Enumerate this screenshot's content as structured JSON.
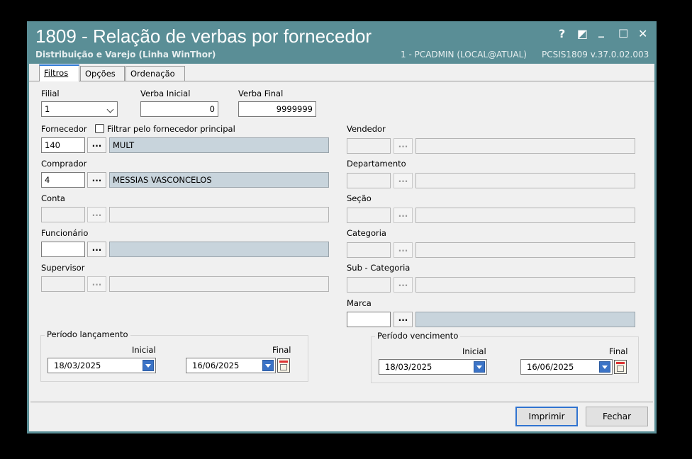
{
  "window": {
    "title": "1809 - Relação de verbas por fornecedor",
    "subtitle": "Distribuição e Varejo (Linha WinThor)",
    "user_info": "1 - PCADMIN (LOCAL@ATUAL)",
    "version": "PCSIS1809  v.37.0.02.003",
    "controls": {
      "help": "?",
      "restore": "◩",
      "minimize": "_",
      "maximize": "☐",
      "close": "✕"
    }
  },
  "tabs": [
    {
      "label": "Filtros",
      "active": true
    },
    {
      "label": "Opções",
      "active": false
    },
    {
      "label": "Ordenação",
      "active": false
    }
  ],
  "filters": {
    "filial": {
      "label": "Filial",
      "value": "1"
    },
    "verba_inicial": {
      "label": "Verba Inicial",
      "value": "0"
    },
    "verba_final": {
      "label": "Verba Final",
      "value": "9999999"
    },
    "fornecedor": {
      "label": "Fornecedor",
      "code": "140",
      "name": "MULT",
      "checkbox_label": "Filtrar pelo fornecedor principal",
      "checked": false
    },
    "comprador": {
      "label": "Comprador",
      "code": "4",
      "name": "MESSIAS VASCONCELOS"
    },
    "conta": {
      "label": "Conta",
      "code": "",
      "name": ""
    },
    "funcionario": {
      "label": "Funcionário",
      "code": "",
      "name": ""
    },
    "supervisor": {
      "label": "Supervisor",
      "code": "",
      "name": ""
    },
    "vendedor": {
      "label": "Vendedor",
      "code": "",
      "name": ""
    },
    "departamento": {
      "label": "Departamento",
      "code": "",
      "name": ""
    },
    "secao": {
      "label": "Seção",
      "code": "",
      "name": ""
    },
    "categoria": {
      "label": "Categoria",
      "code": "",
      "name": ""
    },
    "subcategoria": {
      "label": "Sub - Categoria",
      "code": "",
      "name": ""
    },
    "marca": {
      "label": "Marca",
      "code": "",
      "name": ""
    },
    "lookup_button": "..."
  },
  "periodo_lancamento": {
    "label": "Período lançamento",
    "inicial_label": "Inicial",
    "final_label": "Final",
    "inicial": "18/03/2025",
    "final": "16/06/2025"
  },
  "periodo_vencimento": {
    "label": "Período vencimento",
    "inicial_label": "Inicial",
    "final_label": "Final",
    "inicial": "18/03/2025",
    "final": "16/06/2025"
  },
  "buttons": {
    "imprimir": "Imprimir",
    "fechar": "Fechar"
  },
  "colors": {
    "titlebar": "#5a8e96",
    "readonly_field": "#c8d4dc",
    "accent": "#2f7bd8"
  }
}
